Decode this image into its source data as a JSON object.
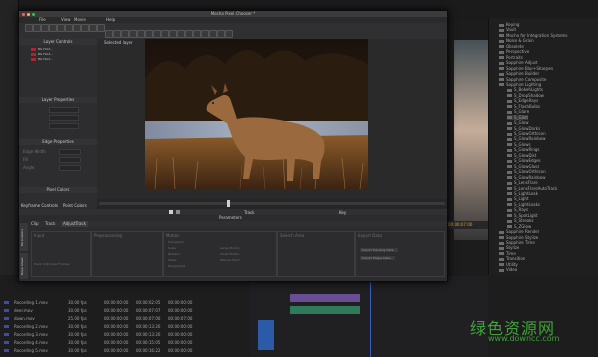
{
  "window": {
    "title": "Mocha Pixel Chooser *"
  },
  "menu": [
    "File",
    "View",
    "Movie",
    "Help"
  ],
  "toolbar": {
    "selected_layer_label": "Selected layer"
  },
  "left_panel": {
    "layer_controls": "Layer Controls",
    "layers": [
      "BG Hold...",
      "BG Hold...",
      "BG Hold..."
    ],
    "layer_properties": "Layer Properties",
    "edge_properties": "Edge Properties",
    "edge_fields": [
      "Edge Width",
      "Fill",
      "Angle"
    ],
    "pixel_colors": "Pixel Colors",
    "bottom_tabs": [
      "Keyframe Controls",
      "Point Colors"
    ]
  },
  "transport": {
    "track_label": "Track",
    "key_label": "Key"
  },
  "parameters": {
    "title": "Parameters",
    "tabs": [
      "Clip",
      "Track",
      "AdjustTrack"
    ],
    "side_tabs": [
      "Parameters",
      "Dope Sheet"
    ],
    "groups": [
      "Input",
      "Preprocessing",
      "Motion",
      "Search Area",
      "Export Data"
    ],
    "motion_options": [
      "Translation",
      "Scale",
      "Rotation",
      "Shear",
      "Perspective"
    ],
    "motion_right": [
      "Large Motion",
      "Small Motion",
      "Manual Track"
    ],
    "buttons": [
      "Track Individual Frames",
      "Export Tracking Data...",
      "Export Shape Data..."
    ]
  },
  "right_tree": {
    "items": [
      "Keying",
      "Vault",
      "Mocha for Integration Systems",
      "Noise & Grain",
      "Obsolete",
      "Perspective",
      "Portraits",
      "Sapphire Adjust",
      "Sapphire Blur+Sharpen",
      "Sapphire Builder",
      "Sapphire Composite",
      "Sapphire Lighting",
      "S_BokehLights",
      "S_DropShadow",
      "S_EdgeRays",
      "S_FlashBulbs",
      "S_Glare",
      "S_Glint",
      "S_Glow",
      "S_GlowDarks",
      "S_GlowOrthicon",
      "S_GlowRainbow",
      "S_Glows",
      "S_GlowRings",
      "S_GlowDist",
      "S_GlowEdges",
      "S_GlowGlass",
      "S_GlowOrthicon",
      "S_GlowRainbow",
      "S_LensFlare",
      "S_LensFlareAutoTrack",
      "S_LightLeak",
      "S_Light",
      "S_LightLeaks",
      "S_Rays",
      "S_SpotLight",
      "S_Streaks",
      "S_ZGlow",
      "Sapphire Render",
      "Sapphire Stylize",
      "Sapphire Time",
      "Stylize",
      "Time",
      "Transition",
      "Utility",
      "Video"
    ],
    "selected_index": 17,
    "timecode": "00:00:07:00"
  },
  "clip_list": {
    "rows": [
      {
        "name": "Recording 1.mov",
        "fps": "30.00 fps",
        "start": "00:00:00:00",
        "end": "00:00:02:05",
        "dur": "00:00:00:00"
      },
      {
        "name": "deer.mov",
        "fps": "30.00 fps",
        "start": "00:00:00:00",
        "end": "00:00:07:07",
        "dur": "00:00:00:00"
      },
      {
        "name": "dawn.mov",
        "fps": "25.00 fps",
        "start": "00:00:00:00",
        "end": "00:00:07:00",
        "dur": "00:00:07:00"
      },
      {
        "name": "Recording 2.mov",
        "fps": "30.00 fps",
        "start": "00:00:00:00",
        "end": "00:00:13:20",
        "dur": "00:00:00:00"
      },
      {
        "name": "Recording 3.mov",
        "fps": "30.00 fps",
        "start": "00:00:00:00",
        "end": "00:00:13:20",
        "dur": "00:00:00:00"
      },
      {
        "name": "Recording 4.mov",
        "fps": "30.00 fps",
        "start": "00:00:00:00",
        "end": "00:00:15:05",
        "dur": "00:00:00:00"
      },
      {
        "name": "Recording 5.mov",
        "fps": "30.00 fps",
        "start": "00:00:00:00",
        "end": "00:00:16:22",
        "dur": "00:00:00:00"
      }
    ]
  },
  "watermark": {
    "cn": "绿色资源网",
    "url": "www.downcc.com"
  }
}
